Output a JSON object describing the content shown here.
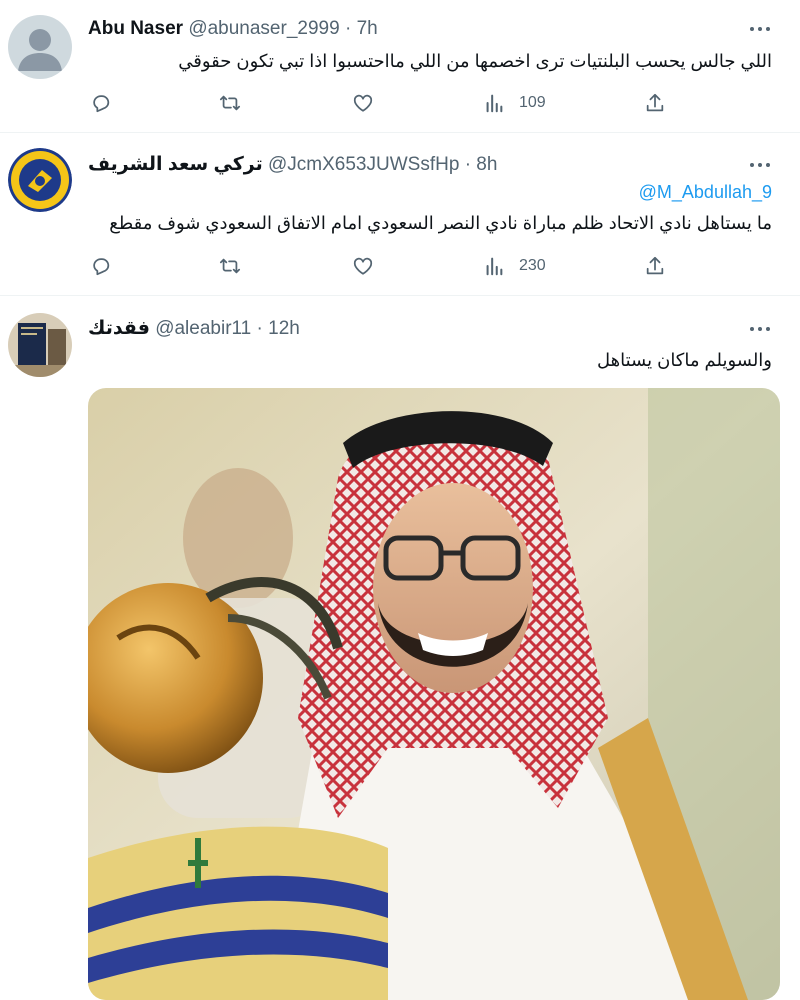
{
  "tweets": [
    {
      "name": "Abu Naser",
      "handle": "@abunaser_2999",
      "dot": "·",
      "time": "7h",
      "text": "اللي جالس يحسب البلنتيات ترى اخصمها من اللي مااحتسبوا اذا تبي تكون حقوقي",
      "views": "109",
      "avatar_icon": "default-avatar-icon"
    },
    {
      "name": "تركي سعد الشريف",
      "handle": "@JcmX653JUWSsfHp",
      "dot": "·",
      "time": "8h",
      "mention": "@M_Abdullah_9",
      "text": "ما يستاهل نادي الاتحاد  ظلم مباراة نادي النصر السعودي امام الاتفاق السعودي شوف مقطع",
      "views": "230",
      "avatar_text_top": "AL NASSR",
      "avatar_text_bottom": "FOOTBALL CLUB"
    },
    {
      "name": "فقدتك",
      "handle": "@aleabir11",
      "dot": "·",
      "time": "12h",
      "text": "والسويلم ماكان يستاهل"
    }
  ],
  "colors": {
    "text": "#0f1419",
    "secondary": "#536471",
    "link": "#1d9bf0",
    "divider": "#eff3f4",
    "nassr_blue": "#1e3a8a",
    "nassr_yellow": "#f5c518"
  }
}
